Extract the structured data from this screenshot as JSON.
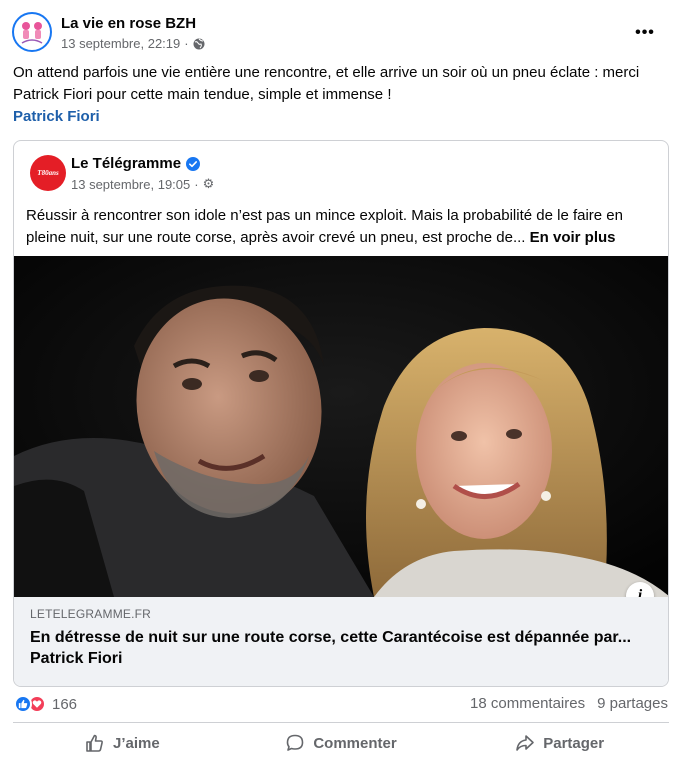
{
  "post": {
    "page_name": "La vie en rose BZH",
    "timestamp": "13 septembre, 22:19",
    "separator": "·",
    "more_label": "•••",
    "text": "On attend parfois une vie entière une rencontre, et elle arrive un soir où un pneu éclate : merci Patrick Fiori pour cette main tendue, simple et immense !",
    "mention": "Patrick Fiori"
  },
  "shared": {
    "avatar_text": "T80ans",
    "page_name": "Le Télégramme",
    "timestamp": "13 septembre, 19:05",
    "separator": "·",
    "text": "Réussir à rencontrer son idole n’est pas un mince exploit. Mais la probabilité de le faire en pleine nuit, sur une route corse, après avoir crevé un pneu, est proche de...",
    "see_more": "En voir plus",
    "info_label": "i",
    "link_domain": "LETELEGRAMME.FR",
    "link_title": "En détresse de nuit sur une route corse, cette Carantécoise est dépannée par... Patrick Fiori"
  },
  "engagement": {
    "reaction_count": "166",
    "comments": "18 commentaires",
    "shares": "9 partages"
  },
  "actions": {
    "like": "J’aime",
    "comment": "Commenter",
    "share": "Partager"
  },
  "colors": {
    "link": "#1e5faa",
    "like": "#1877f2",
    "love": "#f33e58",
    "brand_red": "#e41e26"
  },
  "icons": [
    "globe-icon",
    "verified-icon",
    "gear-icon",
    "info-icon",
    "thumbs-up-icon",
    "heart-icon",
    "comment-icon",
    "share-icon"
  ]
}
